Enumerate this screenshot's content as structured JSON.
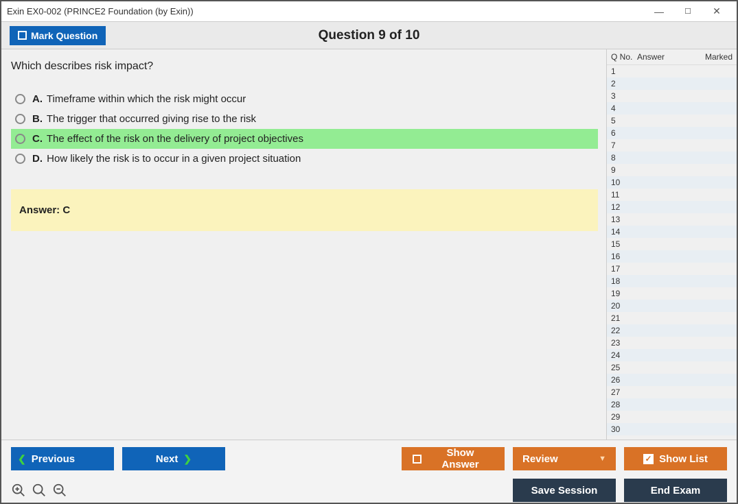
{
  "window": {
    "title": "Exin EX0-002 (PRINCE2 Foundation (by Exin))"
  },
  "topbar": {
    "mark_label": "Mark Question",
    "question_title": "Question 9 of 10"
  },
  "question": {
    "text": "Which describes risk impact?",
    "choices": [
      {
        "letter": "A.",
        "text": "Timeframe within which the risk might occur",
        "selected": false
      },
      {
        "letter": "B.",
        "text": "The trigger that occurred giving rise to the risk",
        "selected": false
      },
      {
        "letter": "C.",
        "text": "The effect of the risk on the delivery of project objectives",
        "selected": true
      },
      {
        "letter": "D.",
        "text": "How likely the risk is to occur in a given project situation",
        "selected": false
      }
    ],
    "answer_label": "Answer: C"
  },
  "list": {
    "header": {
      "qno": "Q No.",
      "answer": "Answer",
      "marked": "Marked"
    },
    "count": 30
  },
  "buttons": {
    "previous": "Previous",
    "next": "Next",
    "show_answer": "Show Answer",
    "review": "Review",
    "show_list": "Show List",
    "save_session": "Save Session",
    "end_exam": "End Exam"
  }
}
